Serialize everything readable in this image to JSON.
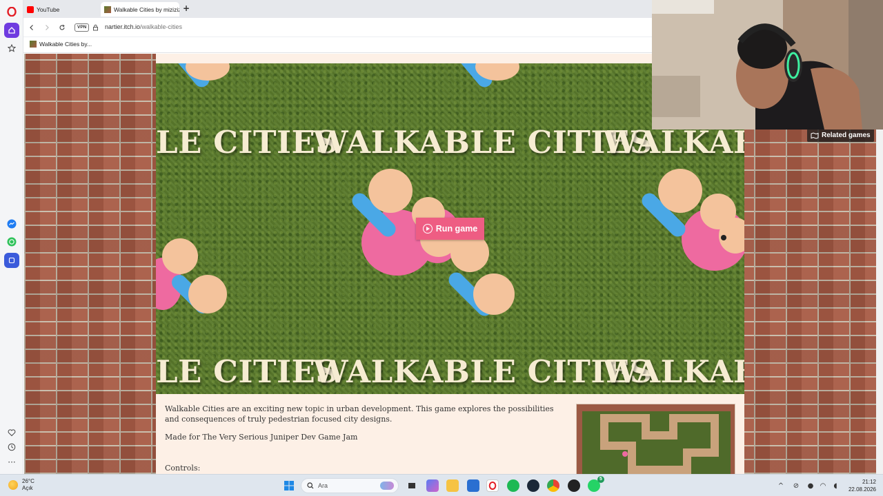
{
  "browser": {
    "tabs": [
      {
        "label": "YouTube",
        "active": false
      },
      {
        "label": "Walkable Cities by miziziz",
        "active": true
      }
    ],
    "new_tab_symbol": "+",
    "vpn_label": "VPN",
    "url_domain": "nartier.itch.io",
    "url_path": "/walkable-cities",
    "bookmark_label": "Walkable Cities by..."
  },
  "page": {
    "banner_word": "WALKABLE CITIES",
    "banner_fragment_left": "LE CITIES",
    "banner_fragment_right": "WALKABI",
    "run_game_label": "Run game",
    "related_games_label": "Related games",
    "description": "Walkable Cities are an exciting new topic in urban development. This game explores the possibilities and consequences of truly pedestrian focused city designs.",
    "made_for": "Made for  The Very Serious Juniper Dev Game Jam",
    "controls_label": "Controls:"
  },
  "taskbar": {
    "temperature": "26°C",
    "weather_text": "Açık",
    "search_placeholder": "Ara",
    "time": "21:12",
    "date": "22.08.2026",
    "whatsapp_badge": "5"
  },
  "colors": {
    "run_button": "#ee5d83",
    "grass": "#5a7a2c",
    "brick": "#a85b45",
    "content_bg": "#fdf0e6",
    "banner_text": "#f6ecd2",
    "character_skin": "#f4c39c",
    "character_body": "#ee6aa0",
    "character_sleeve": "#4aa8e6"
  },
  "icons": [
    "opera-logo-icon",
    "home-icon",
    "star-icon",
    "messenger-icon",
    "whatsapp-icon",
    "player-icon",
    "heart-icon",
    "history-icon",
    "more-icon",
    "back-icon",
    "forward-icon",
    "reload-icon",
    "lock-icon",
    "play-icon",
    "map-icon",
    "windows-start-icon",
    "search-icon"
  ]
}
